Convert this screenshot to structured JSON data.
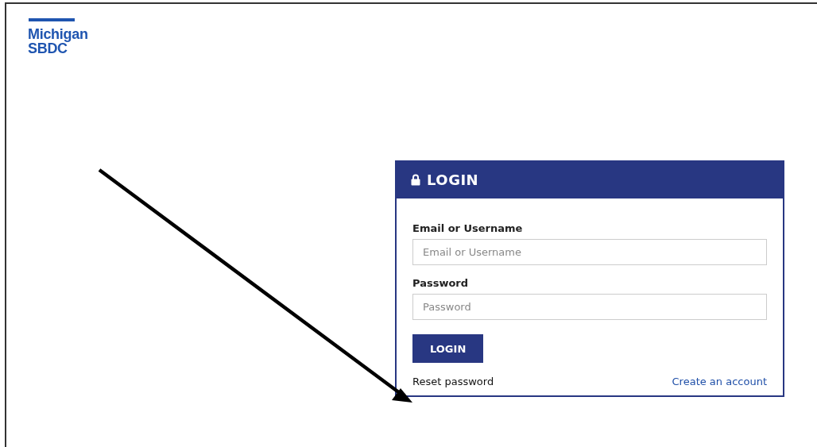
{
  "logo": {
    "line_1": "Michigan",
    "line_2": "SBDC"
  },
  "login": {
    "title": "LOGIN",
    "fields": [
      {
        "label": "Email or Username",
        "placeholder": "Email or Username"
      },
      {
        "label": "Password",
        "placeholder": "Password"
      }
    ],
    "button": "LOGIN",
    "reset_link": "Reset password",
    "create_link": "Create an account"
  }
}
